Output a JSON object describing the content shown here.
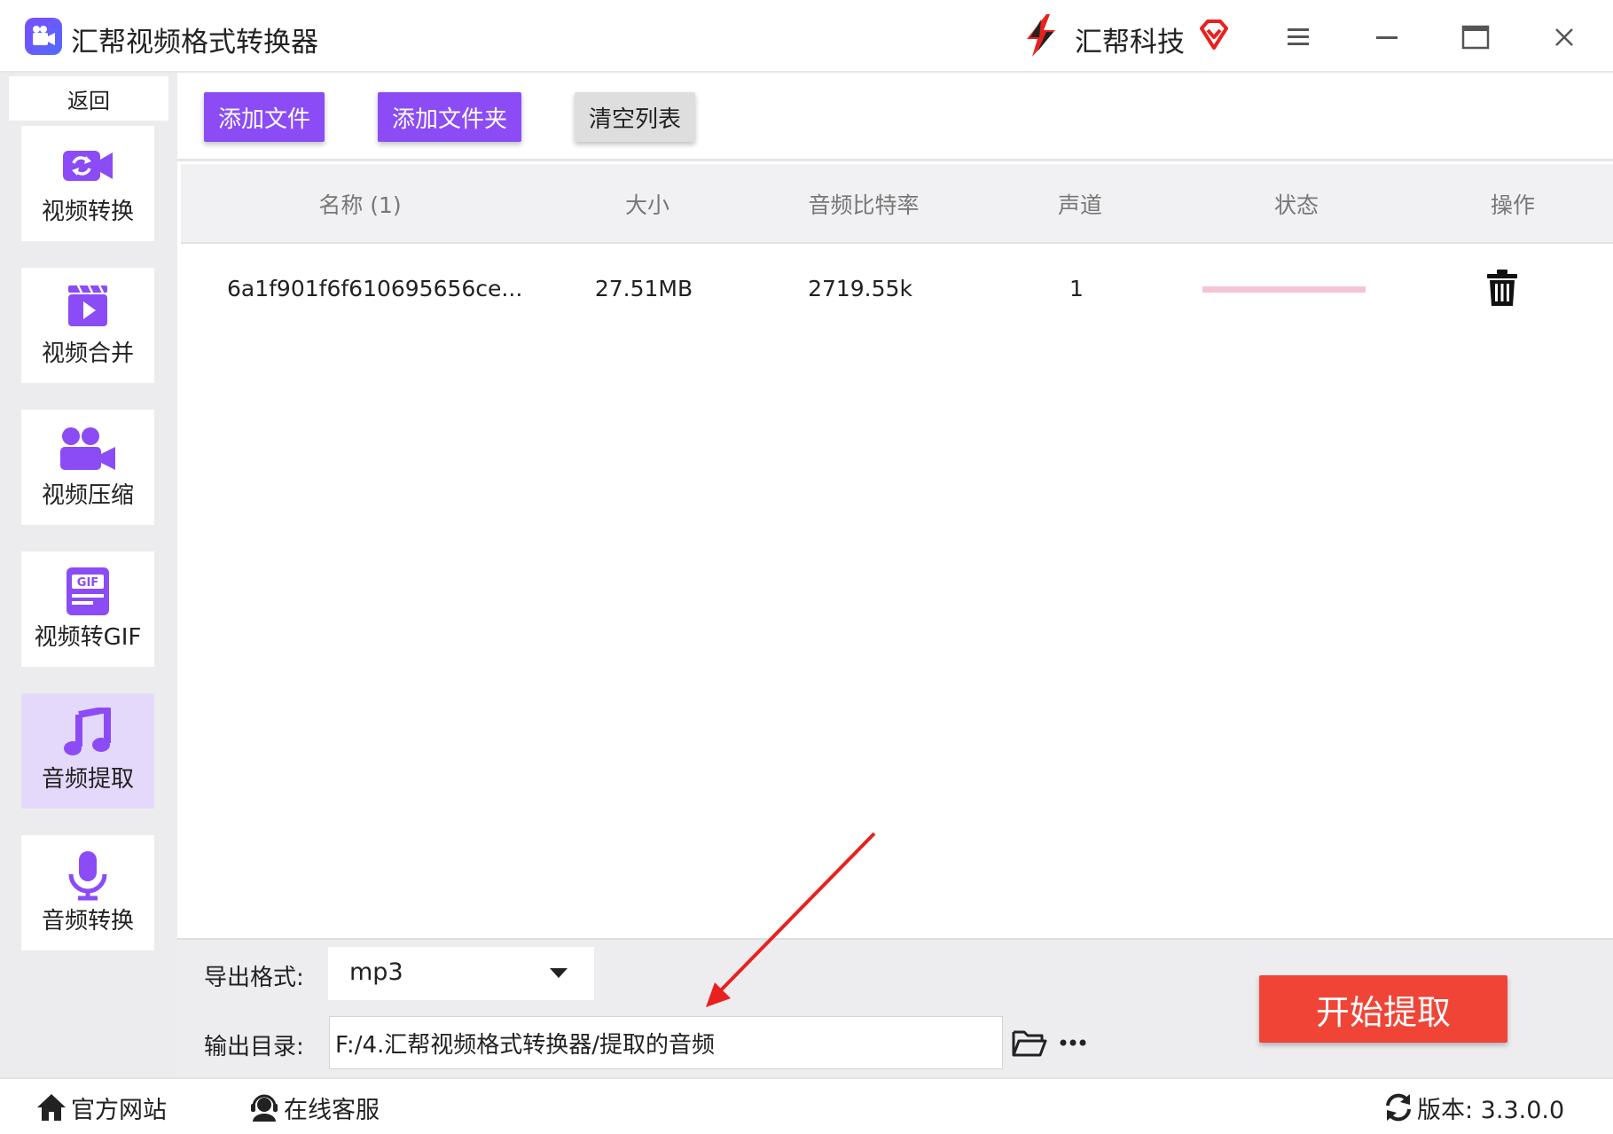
{
  "app": {
    "title": "汇帮视频格式转换器",
    "brand_name": "汇帮科技"
  },
  "window_controls": {
    "menu_icon": "hamburger-icon",
    "minimize_icon": "minimize-icon",
    "maximize_icon": "maximize-icon",
    "close_icon": "close-icon"
  },
  "sidebar": {
    "back_label": "返回",
    "items": [
      {
        "label": "视频转换",
        "icon": "video-convert-icon",
        "active": false
      },
      {
        "label": "视频合并",
        "icon": "video-merge-icon",
        "active": false
      },
      {
        "label": "视频压缩",
        "icon": "video-compress-icon",
        "active": false
      },
      {
        "label": "视频转GIF",
        "icon": "gif-icon",
        "active": false
      },
      {
        "label": "音频提取",
        "icon": "music-note-icon",
        "active": true
      },
      {
        "label": "音频转换",
        "icon": "microphone-icon",
        "active": false
      }
    ]
  },
  "toolbar": {
    "add_file_label": "添加文件",
    "add_folder_label": "添加文件夹",
    "clear_list_label": "清空列表"
  },
  "table": {
    "columns": [
      "名称 (1)",
      "大小",
      "音频比特率",
      "声道",
      "状态",
      "操作"
    ],
    "rows": [
      {
        "name": "6a1f901f6f610695656ce...",
        "size": "27.51MB",
        "bitrate": "2719.55k",
        "channels": "1",
        "status_progress": 0,
        "action_icon": "trash-icon"
      }
    ]
  },
  "settings": {
    "format_label": "导出格式:",
    "format_value": "mp3",
    "output_label": "输出目录:",
    "output_path": "F:/4.汇帮视频格式转换器/提取的音频",
    "start_label": "开始提取"
  },
  "footer": {
    "website_label": "官方网站",
    "support_label": "在线客服",
    "version_label": "版本: 3.3.0.0"
  },
  "colors": {
    "accent_purple": "#8b4cf6",
    "start_red": "#f04437",
    "annotation_red": "#e8211f"
  }
}
